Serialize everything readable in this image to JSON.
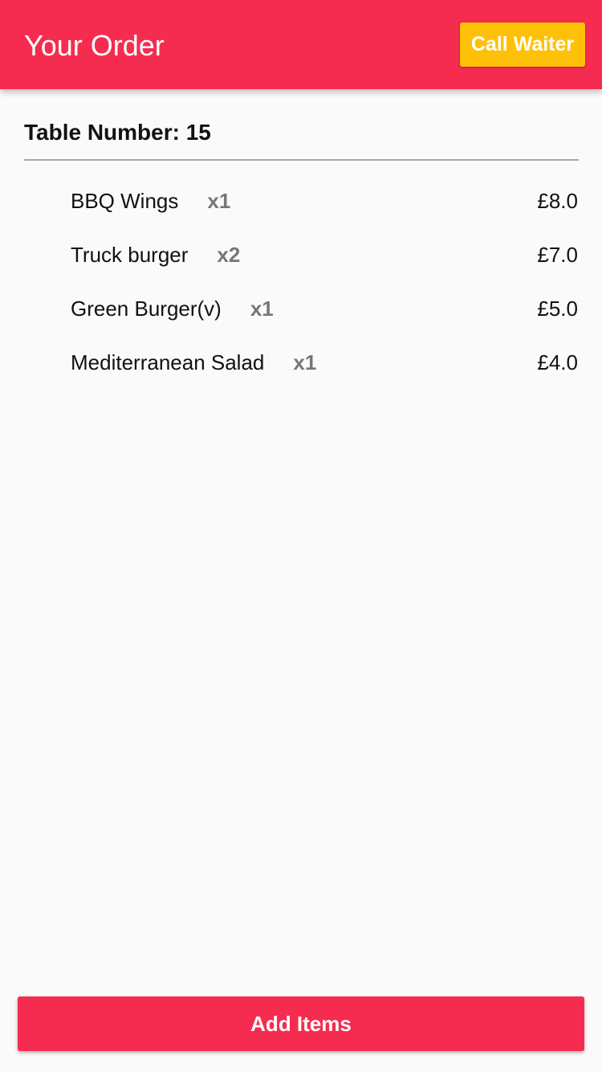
{
  "colors": {
    "primary": "#f52c4f",
    "accent": "#ffc107",
    "background": "#fafafa",
    "quantity_text": "#777777"
  },
  "header": {
    "title": "Your Order",
    "call_waiter_label": "Call Waiter"
  },
  "table": {
    "label": "Table Number: 15"
  },
  "order": {
    "items": [
      {
        "name": "BBQ Wings",
        "qty": "x1",
        "price": "£8.0"
      },
      {
        "name": "Truck burger",
        "qty": "x2",
        "price": "£7.0"
      },
      {
        "name": "Green Burger(v)",
        "qty": "x1",
        "price": "£5.0"
      },
      {
        "name": "Mediterranean Salad",
        "qty": "x1",
        "price": "£4.0"
      }
    ]
  },
  "footer": {
    "add_items_label": "Add Items"
  }
}
